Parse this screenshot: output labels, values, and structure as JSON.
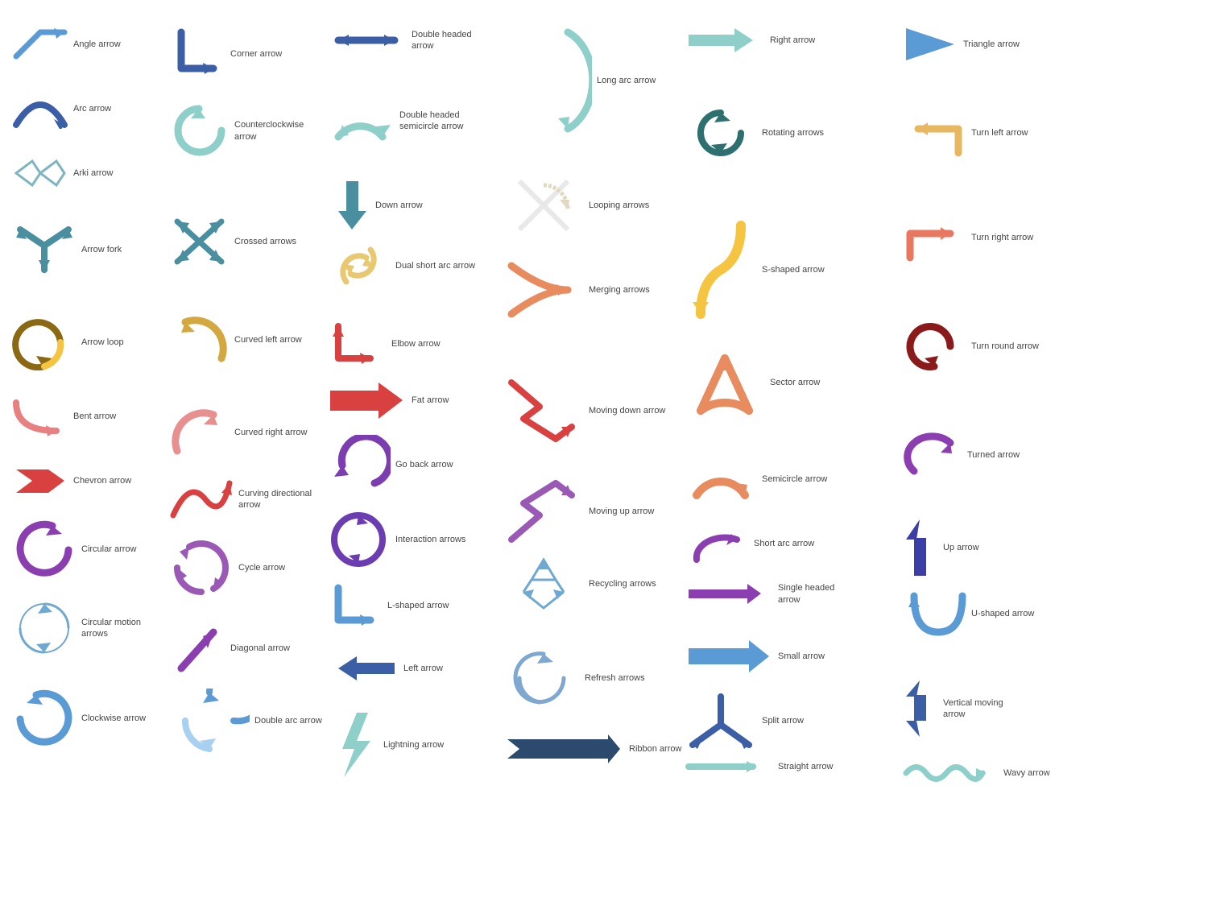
{
  "arrows": [
    {
      "label": "Angle arrow"
    },
    {
      "label": "Arc arrow"
    },
    {
      "label": "Arki arrow"
    },
    {
      "label": "Arrow fork"
    },
    {
      "label": "Arrow loop"
    },
    {
      "label": "Bent arrow"
    },
    {
      "label": "Chevron arrow"
    },
    {
      "label": "Circular arrow"
    },
    {
      "label": "Circular motion arrows"
    },
    {
      "label": "Clockwise arrow"
    },
    {
      "label": "Corner arrow"
    },
    {
      "label": "Counterclockwise arrow"
    },
    {
      "label": "Crossed arrows"
    },
    {
      "label": "Curved left arrow"
    },
    {
      "label": "Curved right arrow"
    },
    {
      "label": "Curving directional arrow"
    },
    {
      "label": "Cycle arrow"
    },
    {
      "label": "Diagonal arrow"
    },
    {
      "label": "Double arc arrow"
    },
    {
      "label": "Double headed arrow"
    },
    {
      "label": "Double headed semicircle arrow"
    },
    {
      "label": "Down arrow"
    },
    {
      "label": "Dual short arc arrow"
    },
    {
      "label": "Elbow arrow"
    },
    {
      "label": "Fat arrow"
    },
    {
      "label": "Go back arrow"
    },
    {
      "label": "Interaction arrows"
    },
    {
      "label": "L-shaped arrow"
    },
    {
      "label": "Left arrow"
    },
    {
      "label": "Lightning arrow"
    },
    {
      "label": "Long arc arrow"
    },
    {
      "label": "Looping arrows"
    },
    {
      "label": "Merging arrows"
    },
    {
      "label": "Moving down arrow"
    },
    {
      "label": "Moving up arrow"
    },
    {
      "label": "Recycling arrows"
    },
    {
      "label": "Refresh arrows"
    },
    {
      "label": "Ribbon arrow"
    },
    {
      "label": "Right arrow"
    },
    {
      "label": "Rotating arrows"
    },
    {
      "label": "S-shaped arrow"
    },
    {
      "label": "Sector arrow"
    },
    {
      "label": "Semicircle arrow"
    },
    {
      "label": "Short arc arrow"
    },
    {
      "label": "Single headed arrow"
    },
    {
      "label": "Small arrow"
    },
    {
      "label": "Split arrow"
    },
    {
      "label": "Straight arrow"
    },
    {
      "label": "Triangle arrow"
    },
    {
      "label": "Turn left arrow"
    },
    {
      "label": "Turn right arrow"
    },
    {
      "label": "Turn round arrow"
    },
    {
      "label": "Turned arrow"
    },
    {
      "label": "Up arrow"
    },
    {
      "label": "U-shaped arrow"
    },
    {
      "label": "Vertical moving arrow"
    },
    {
      "label": "Wavy arrow"
    }
  ]
}
